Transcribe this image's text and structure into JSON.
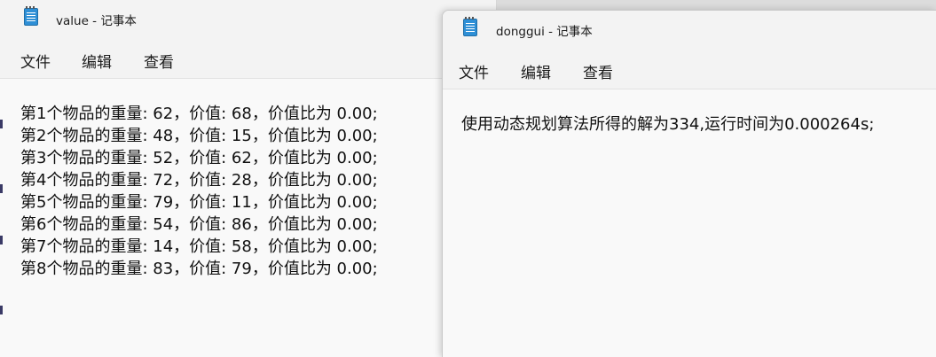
{
  "left_window": {
    "title": "value - 记事本",
    "menu": [
      "文件",
      "编辑",
      "查看"
    ],
    "lines": [
      "第1个物品的重量: 62，价值: 68，价值比为 0.00;",
      "第2个物品的重量: 48，价值: 15，价值比为 0.00;",
      "第3个物品的重量: 52，价值: 62，价值比为 0.00;",
      "第4个物品的重量: 72，价值: 28，价值比为 0.00;",
      "第5个物品的重量: 79，价值: 11，价值比为 0.00;",
      "第6个物品的重量: 54，价值: 86，价值比为 0.00;",
      "第7个物品的重量: 14，价值: 58，价值比为 0.00;",
      "第8个物品的重量: 83，价值: 79，价值比为 0.00;"
    ]
  },
  "right_window": {
    "title": "donggui - 记事本",
    "menu": [
      "文件",
      "编辑",
      "查看"
    ],
    "lines": [
      "使用动态规划算法所得的解为334,运行时间为0.000264s;"
    ]
  },
  "icons": {
    "app_icon": "notepad-icon"
  },
  "colors": {
    "window_bg": "#f9f9f9",
    "chrome_bg": "#f3f3f3",
    "text": "#111111",
    "app_icon": "#2e8fd6"
  }
}
